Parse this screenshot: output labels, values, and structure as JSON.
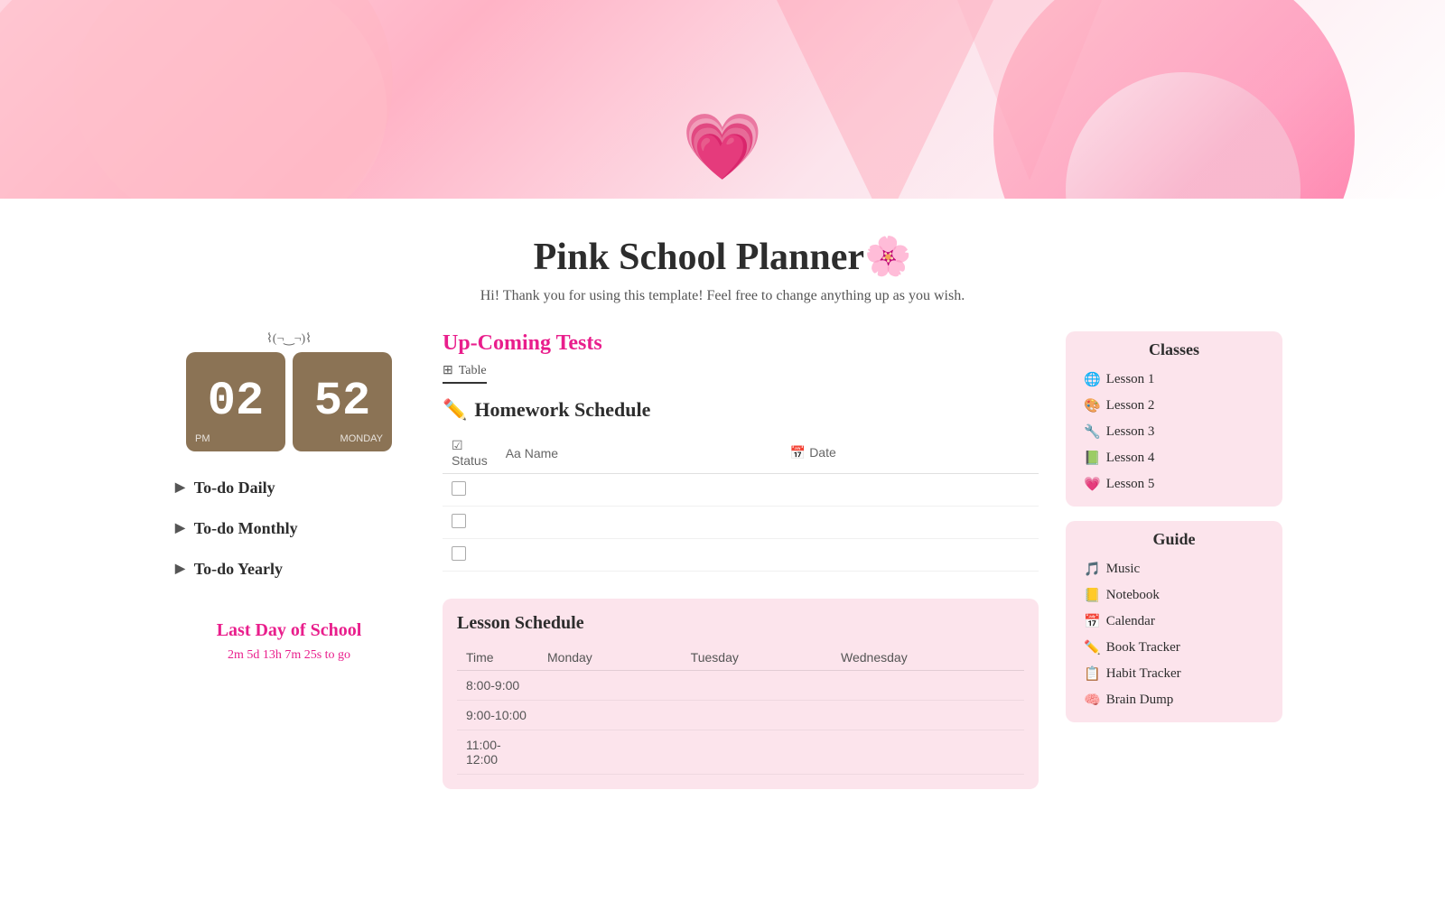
{
  "header": {
    "background_alt": "Pink decorative banner"
  },
  "title": {
    "heart_emoji": "💗",
    "page_title": "Pink School Planner🌸",
    "subtitle": "Hi! Thank you for using this template! Feel free to change anything up as you wish."
  },
  "clock": {
    "kaomoji": "⌇(¬‿¬)⌇",
    "hour": "02",
    "minute": "52",
    "label_pm": "PM",
    "label_monday": "MONDAY"
  },
  "nav": {
    "items": [
      {
        "label": "To-do Daily"
      },
      {
        "label": "To-do Monthly"
      },
      {
        "label": "To-do Yearly"
      }
    ]
  },
  "last_day": {
    "title": "Last Day of School",
    "countdown": "2m 5d 13h 7m 25s to go"
  },
  "upcoming_tests": {
    "section_title": "Up-Coming Tests",
    "tab_label": "Table"
  },
  "homework": {
    "title": "Homework Schedule",
    "pencil_emoji": "✏️",
    "columns": [
      {
        "icon": "☑",
        "label": "Status"
      },
      {
        "icon": "Aa",
        "label": "Name"
      },
      {
        "icon": "📅",
        "label": "Date"
      }
    ],
    "rows": [
      {
        "checked": false,
        "name": "",
        "date": ""
      },
      {
        "checked": false,
        "name": "",
        "date": ""
      },
      {
        "checked": false,
        "name": "",
        "date": ""
      }
    ]
  },
  "lesson_schedule": {
    "title": "Lesson Schedule",
    "columns": [
      "Time",
      "Monday",
      "Tuesday",
      "Wednesday"
    ],
    "rows": [
      {
        "time": "8:00-9:00",
        "monday": "",
        "tuesday": "",
        "wednesday": ""
      },
      {
        "time": "9:00-10:00",
        "monday": "",
        "tuesday": "",
        "wednesday": ""
      },
      {
        "time": "11:00-12:00",
        "monday": "",
        "tuesday": "",
        "wednesday": ""
      }
    ]
  },
  "classes": {
    "title": "Classes",
    "items": [
      {
        "emoji": "🌐",
        "label": "Lesson 1"
      },
      {
        "emoji": "🎨",
        "label": "Lesson 2"
      },
      {
        "emoji": "🔧",
        "label": "Lesson 3"
      },
      {
        "emoji": "📗",
        "label": "Lesson 4"
      },
      {
        "emoji": "💗",
        "label": "Lesson 5"
      }
    ]
  },
  "guide": {
    "title": "Guide",
    "items": [
      {
        "emoji": "🎵",
        "label": "Music"
      },
      {
        "emoji": "📒",
        "label": "Notebook"
      },
      {
        "emoji": "📅",
        "label": "Calendar"
      },
      {
        "emoji": "✏️",
        "label": "Book Tracker"
      },
      {
        "emoji": "📋",
        "label": "Habit Tracker"
      },
      {
        "emoji": "🧠",
        "label": "Brain Dump"
      }
    ]
  }
}
